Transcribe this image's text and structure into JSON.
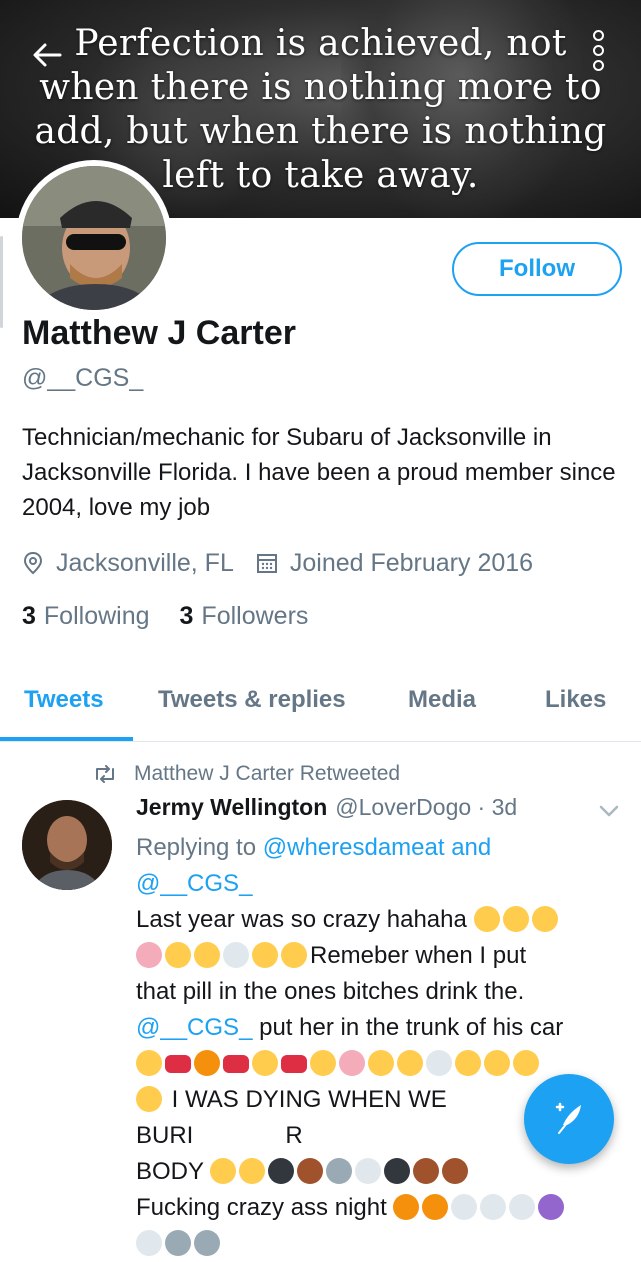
{
  "banner": {
    "quote_lines": [
      "Perfection is achieved, not",
      "when there is nothing more to",
      "add, but when there is nothing",
      "left to take away."
    ]
  },
  "profile": {
    "follow_label": "Follow",
    "name": "Matthew J Carter",
    "handle": "@__CGS_",
    "bio": "Technician/mechanic for Subaru of Jacksonville in Jacksonville Florida. I have been a proud member since 2004, love my job",
    "location": "Jacksonville, FL",
    "joined": "Joined February 2016",
    "following_count": "3",
    "following_label": "Following",
    "followers_count": "3",
    "followers_label": "Followers"
  },
  "tabs": [
    {
      "label": "Tweets",
      "active": true
    },
    {
      "label": "Tweets & replies",
      "active": false
    },
    {
      "label": "Media",
      "active": false
    },
    {
      "label": "Likes",
      "active": false
    }
  ],
  "tweet": {
    "retweet_notice": "Matthew J Carter Retweeted",
    "author_name": "Jermy Wellington",
    "author_handle": "@LoverDogo · 3d",
    "replying_prefix": "Replying to",
    "replying_to_1": "@wheresdameat and",
    "replying_to_2": "@__CGS_",
    "text_1": "Last year was so crazy hahaha",
    "text_2": "Remeber when I put",
    "text_3": "that pill in the ones bitches drink the.",
    "mention": "@__CGS_",
    "text_4": "put her in the trunk of his car",
    "text_5": "I WAS DYING WHEN WE BURI",
    "text_5b": "R",
    "text_6": "BODY",
    "text_7": "Fucking crazy ass night"
  },
  "colors": {
    "accent": "#1da1f2",
    "text_primary": "#14171a",
    "text_secondary": "#657786",
    "divider": "#e1e8ed"
  },
  "icons": {
    "back": "arrow-left-icon",
    "more": "vertical-dots-icon",
    "location": "location-pin-icon",
    "calendar": "calendar-icon",
    "retweet": "retweet-icon",
    "chevron": "chevron-down-icon",
    "compose": "compose-tweet-icon"
  }
}
